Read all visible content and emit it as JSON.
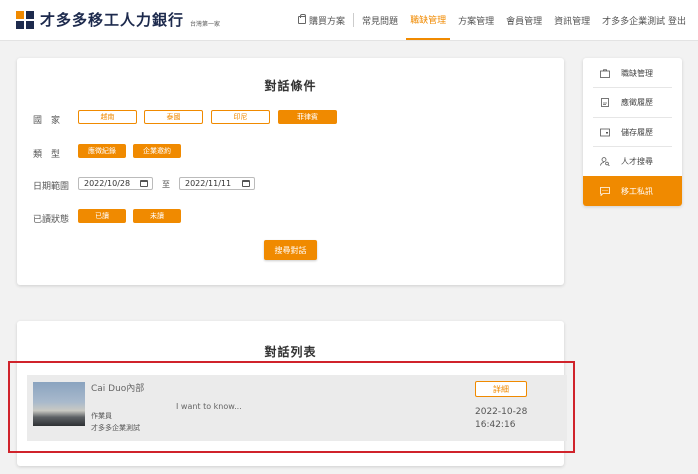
{
  "header": {
    "brand": "才多多移工人力銀行",
    "brand_sub": "台灣第一家",
    "nav": {
      "buy_plan": "購買方案",
      "faq": "常見問題",
      "job_manage": "職缺管理",
      "plan_manage": "方案管理",
      "member_manage": "會員管理",
      "info_manage": "資訊管理",
      "company_logout": "才多多企業測試 登出"
    }
  },
  "filter": {
    "title": "對話條件",
    "country_label": "國　家",
    "countries": [
      "越南",
      "泰國",
      "印尼",
      "菲律賓"
    ],
    "type_label": "類　型",
    "types": [
      "應徵紀錄",
      "企業邀約"
    ],
    "date_label": "日期範圍",
    "date_from": "2022/10/28",
    "date_to_label": "至",
    "date_to": "2022/11/11",
    "read_label": "已讀狀態",
    "read_options": [
      "已讀",
      "未讀"
    ],
    "search_button": "搜尋對話"
  },
  "sidebar": {
    "items": [
      {
        "label": "職缺管理",
        "icon": "briefcase-icon"
      },
      {
        "label": "應徵履歷",
        "icon": "document-icon"
      },
      {
        "label": "儲存履歷",
        "icon": "wallet-icon"
      },
      {
        "label": "人才搜尋",
        "icon": "user-search-icon"
      },
      {
        "label": "移工私訊",
        "icon": "chat-icon"
      }
    ]
  },
  "list": {
    "title": "對話列表",
    "conversations": [
      {
        "name": "Cai Duo內部",
        "role": "作業員",
        "company": "才多多企業測試",
        "message": "I want to know...",
        "detail_button": "詳細",
        "date": "2022-10-28",
        "time": "16:42:16"
      }
    ]
  },
  "colors": {
    "accent": "#f08a00",
    "highlight": "#d0232b",
    "brand_dark": "#1d2a4d"
  }
}
